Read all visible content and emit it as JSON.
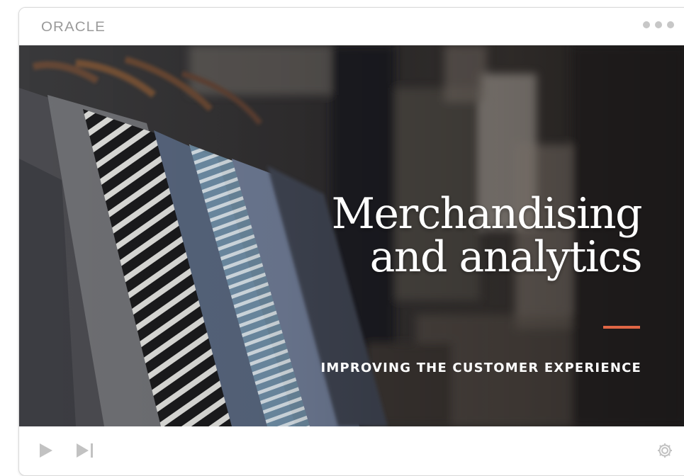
{
  "header": {
    "logo_text": "ORACLE",
    "more_icon": "ellipsis-dots-icon"
  },
  "slide": {
    "title_line1": "Merchandising",
    "title_line2": "and analytics",
    "subtitle": "IMPROVING THE CUSTOMER EXPERIENCE",
    "accent_color": "#e06645",
    "background_image": "clothes hanging on a rack"
  },
  "player_controls": {
    "play_icon": "play-icon",
    "next_icon": "skip-next-icon",
    "settings_icon": "gear-icon"
  }
}
